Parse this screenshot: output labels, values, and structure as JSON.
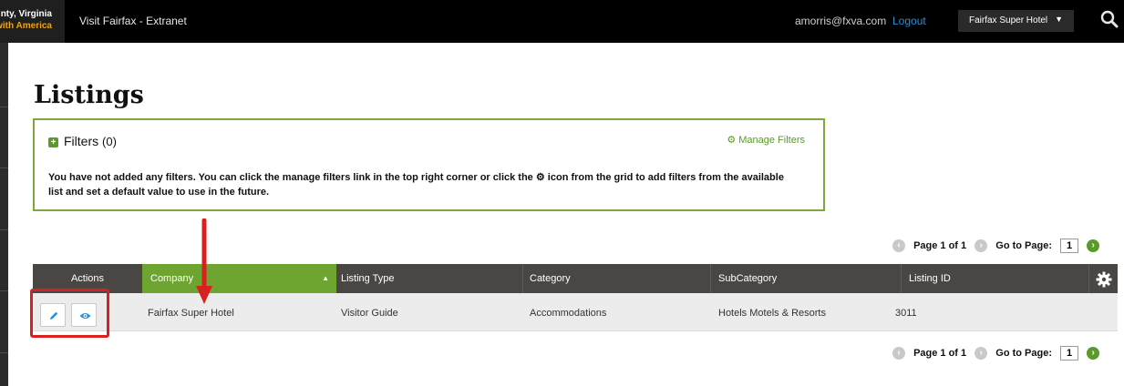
{
  "topbar": {
    "brand_line1": "nty, Virginia",
    "brand_line2": "with America",
    "app_title": "Visit Fairfax - Extranet",
    "user_email": "amorris@fxva.com",
    "logout": "Logout",
    "hotel_select": "Fairfax Super Hotel",
    "search_icon": "search-icon"
  },
  "page": {
    "title": "Listings"
  },
  "filters": {
    "title": "Filters",
    "count": "(0)",
    "manage_label": "Manage Filters",
    "message_part1": "You have not added any filters. You can click the manage filters link in the top right corner or click the",
    "message_part2": "icon from the grid to add filters from the available list and set a default value to use in the future."
  },
  "pager": {
    "page_of": "Page 1 of 1",
    "goto_label": "Go to Page:",
    "goto_value": "1"
  },
  "grid": {
    "columns": [
      "Actions",
      "Company",
      "Listing Type",
      "Category",
      "SubCategory",
      "Listing ID"
    ],
    "sorted_column": "Company",
    "rows": [
      {
        "company": "Fairfax Super Hotel",
        "listing_type": "Visitor Guide",
        "category": "Accommodations",
        "subcategory": "Hotels Motels & Resorts",
        "listing_id": "3011"
      }
    ]
  },
  "colors": {
    "accent_green": "#6ea531",
    "header_dark": "#4a4643",
    "highlight_red": "#d82020",
    "link_blue": "#2b8fd6"
  }
}
